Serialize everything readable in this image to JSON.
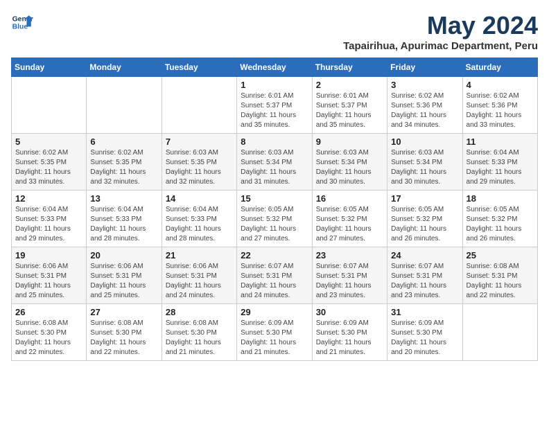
{
  "logo": {
    "line1": "General",
    "line2": "Blue"
  },
  "title": "May 2024",
  "subtitle": "Tapairihua, Apurimac Department, Peru",
  "weekdays": [
    "Sunday",
    "Monday",
    "Tuesday",
    "Wednesday",
    "Thursday",
    "Friday",
    "Saturday"
  ],
  "weeks": [
    [
      {
        "day": "",
        "info": ""
      },
      {
        "day": "",
        "info": ""
      },
      {
        "day": "",
        "info": ""
      },
      {
        "day": "1",
        "info": "Sunrise: 6:01 AM\nSunset: 5:37 PM\nDaylight: 11 hours\nand 35 minutes."
      },
      {
        "day": "2",
        "info": "Sunrise: 6:01 AM\nSunset: 5:37 PM\nDaylight: 11 hours\nand 35 minutes."
      },
      {
        "day": "3",
        "info": "Sunrise: 6:02 AM\nSunset: 5:36 PM\nDaylight: 11 hours\nand 34 minutes."
      },
      {
        "day": "4",
        "info": "Sunrise: 6:02 AM\nSunset: 5:36 PM\nDaylight: 11 hours\nand 33 minutes."
      }
    ],
    [
      {
        "day": "5",
        "info": "Sunrise: 6:02 AM\nSunset: 5:35 PM\nDaylight: 11 hours\nand 33 minutes."
      },
      {
        "day": "6",
        "info": "Sunrise: 6:02 AM\nSunset: 5:35 PM\nDaylight: 11 hours\nand 32 minutes."
      },
      {
        "day": "7",
        "info": "Sunrise: 6:03 AM\nSunset: 5:35 PM\nDaylight: 11 hours\nand 32 minutes."
      },
      {
        "day": "8",
        "info": "Sunrise: 6:03 AM\nSunset: 5:34 PM\nDaylight: 11 hours\nand 31 minutes."
      },
      {
        "day": "9",
        "info": "Sunrise: 6:03 AM\nSunset: 5:34 PM\nDaylight: 11 hours\nand 30 minutes."
      },
      {
        "day": "10",
        "info": "Sunrise: 6:03 AM\nSunset: 5:34 PM\nDaylight: 11 hours\nand 30 minutes."
      },
      {
        "day": "11",
        "info": "Sunrise: 6:04 AM\nSunset: 5:33 PM\nDaylight: 11 hours\nand 29 minutes."
      }
    ],
    [
      {
        "day": "12",
        "info": "Sunrise: 6:04 AM\nSunset: 5:33 PM\nDaylight: 11 hours\nand 29 minutes."
      },
      {
        "day": "13",
        "info": "Sunrise: 6:04 AM\nSunset: 5:33 PM\nDaylight: 11 hours\nand 28 minutes."
      },
      {
        "day": "14",
        "info": "Sunrise: 6:04 AM\nSunset: 5:33 PM\nDaylight: 11 hours\nand 28 minutes."
      },
      {
        "day": "15",
        "info": "Sunrise: 6:05 AM\nSunset: 5:32 PM\nDaylight: 11 hours\nand 27 minutes."
      },
      {
        "day": "16",
        "info": "Sunrise: 6:05 AM\nSunset: 5:32 PM\nDaylight: 11 hours\nand 27 minutes."
      },
      {
        "day": "17",
        "info": "Sunrise: 6:05 AM\nSunset: 5:32 PM\nDaylight: 11 hours\nand 26 minutes."
      },
      {
        "day": "18",
        "info": "Sunrise: 6:05 AM\nSunset: 5:32 PM\nDaylight: 11 hours\nand 26 minutes."
      }
    ],
    [
      {
        "day": "19",
        "info": "Sunrise: 6:06 AM\nSunset: 5:31 PM\nDaylight: 11 hours\nand 25 minutes."
      },
      {
        "day": "20",
        "info": "Sunrise: 6:06 AM\nSunset: 5:31 PM\nDaylight: 11 hours\nand 25 minutes."
      },
      {
        "day": "21",
        "info": "Sunrise: 6:06 AM\nSunset: 5:31 PM\nDaylight: 11 hours\nand 24 minutes."
      },
      {
        "day": "22",
        "info": "Sunrise: 6:07 AM\nSunset: 5:31 PM\nDaylight: 11 hours\nand 24 minutes."
      },
      {
        "day": "23",
        "info": "Sunrise: 6:07 AM\nSunset: 5:31 PM\nDaylight: 11 hours\nand 23 minutes."
      },
      {
        "day": "24",
        "info": "Sunrise: 6:07 AM\nSunset: 5:31 PM\nDaylight: 11 hours\nand 23 minutes."
      },
      {
        "day": "25",
        "info": "Sunrise: 6:08 AM\nSunset: 5:31 PM\nDaylight: 11 hours\nand 22 minutes."
      }
    ],
    [
      {
        "day": "26",
        "info": "Sunrise: 6:08 AM\nSunset: 5:30 PM\nDaylight: 11 hours\nand 22 minutes."
      },
      {
        "day": "27",
        "info": "Sunrise: 6:08 AM\nSunset: 5:30 PM\nDaylight: 11 hours\nand 22 minutes."
      },
      {
        "day": "28",
        "info": "Sunrise: 6:08 AM\nSunset: 5:30 PM\nDaylight: 11 hours\nand 21 minutes."
      },
      {
        "day": "29",
        "info": "Sunrise: 6:09 AM\nSunset: 5:30 PM\nDaylight: 11 hours\nand 21 minutes."
      },
      {
        "day": "30",
        "info": "Sunrise: 6:09 AM\nSunset: 5:30 PM\nDaylight: 11 hours\nand 21 minutes."
      },
      {
        "day": "31",
        "info": "Sunrise: 6:09 AM\nSunset: 5:30 PM\nDaylight: 11 hours\nand 20 minutes."
      },
      {
        "day": "",
        "info": ""
      }
    ]
  ]
}
